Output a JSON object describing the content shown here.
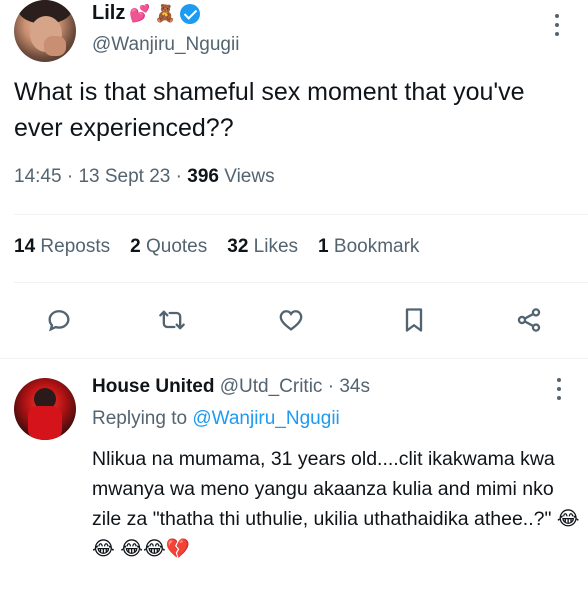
{
  "tweet": {
    "display_name": "Lilz",
    "name_emojis": [
      "💕",
      "🧸"
    ],
    "handle": "@Wanjiru_Ngugii",
    "text": "What is that shameful sex moment that you've ever experienced??",
    "time": "14:45",
    "date": "13 Sept 23",
    "views_count": "396",
    "views_label": "Views",
    "stats": {
      "reposts_count": "14",
      "reposts_label": "Reposts",
      "quotes_count": "2",
      "quotes_label": "Quotes",
      "likes_count": "32",
      "likes_label": "Likes",
      "bookmarks_count": "1",
      "bookmarks_label": "Bookmark"
    },
    "actions": [
      "reply-icon",
      "repost-icon",
      "like-icon",
      "bookmark-icon",
      "share-icon"
    ]
  },
  "reply": {
    "display_name": "House United",
    "handle": "@Utd_Critic",
    "time_ago": "34s",
    "replying_prefix": "Replying to",
    "replying_to": "@Wanjiru_Ngugii",
    "text": "Nlikua na mumama, 31 years old....clit ikakwama kwa mwanya wa meno yangu akaanza kulia and mimi nko zile za  \"thatha thi uthulie, ukilia uthathaidika athee..?\" 😂😂 😂😂💔"
  },
  "colors": {
    "primary_text": "#0f1419",
    "secondary_text": "#536471",
    "accent": "#1d9bf0",
    "divider": "#eff3f4"
  }
}
